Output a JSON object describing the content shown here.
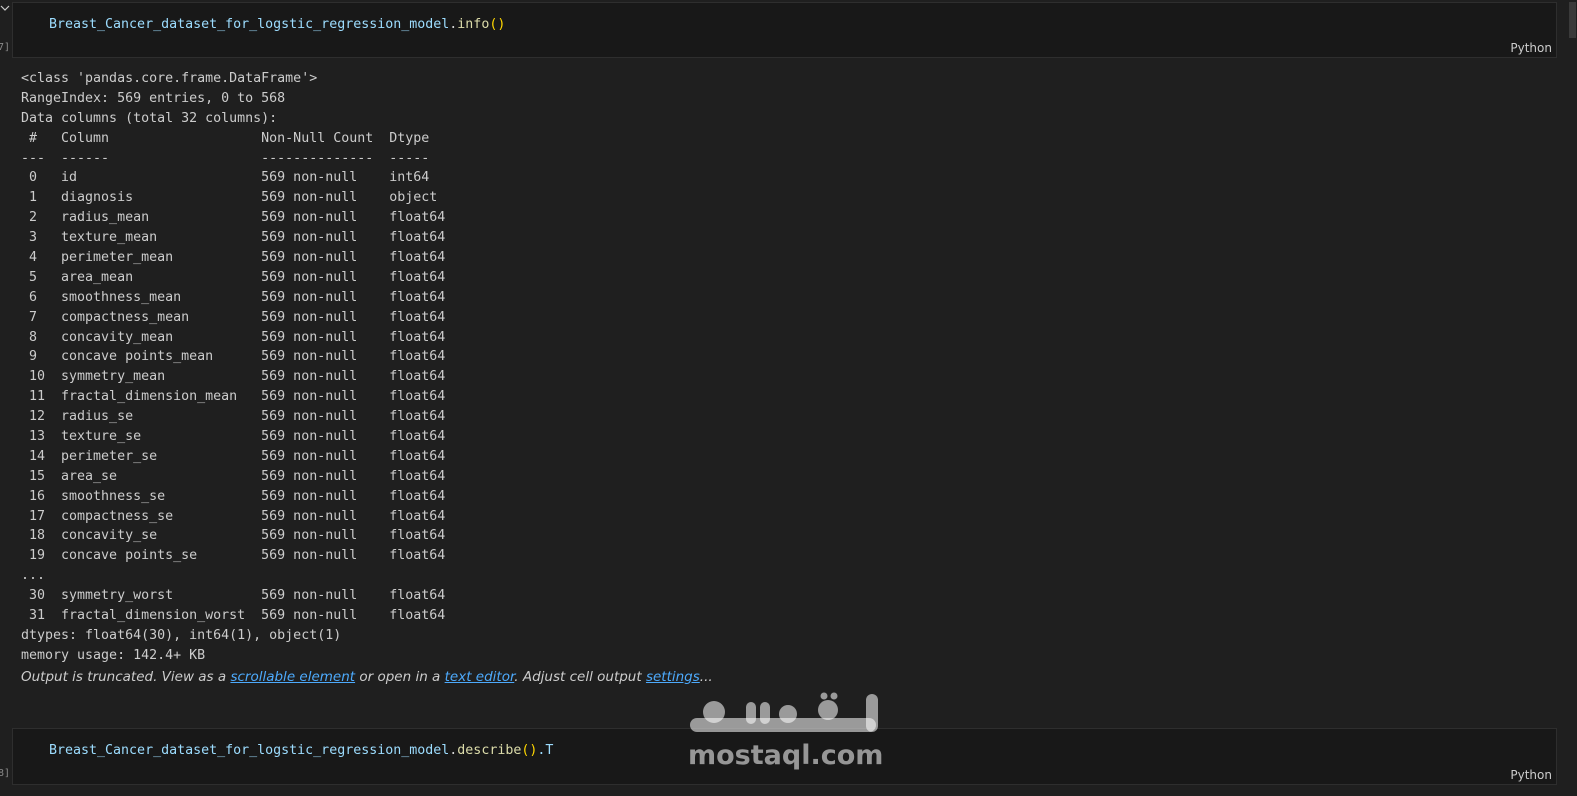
{
  "cells": [
    {
      "exec_label": "7]",
      "code_object": "Breast_Cancer_dataset_for_logstic_regression_model",
      "code_method": "info",
      "code_args": "()",
      "code_suffix": "",
      "language": "Python"
    },
    {
      "exec_label": "8]",
      "code_object": "Breast_Cancer_dataset_for_logstic_regression_model",
      "code_method": "describe",
      "code_args": "()",
      "code_suffix": ".T",
      "language": "Python"
    }
  ],
  "output": {
    "lines": [
      "<class 'pandas.core.frame.DataFrame'>",
      "RangeIndex: 569 entries, 0 to 568",
      "Data columns (total 32 columns):",
      " #   Column                   Non-Null Count  Dtype  ",
      "---  ------                   --------------  -----  ",
      " 0   id                       569 non-null    int64  ",
      " 1   diagnosis                569 non-null    object ",
      " 2   radius_mean              569 non-null    float64",
      " 3   texture_mean             569 non-null    float64",
      " 4   perimeter_mean           569 non-null    float64",
      " 5   area_mean                569 non-null    float64",
      " 6   smoothness_mean          569 non-null    float64",
      " 7   compactness_mean         569 non-null    float64",
      " 8   concavity_mean           569 non-null    float64",
      " 9   concave points_mean      569 non-null    float64",
      " 10  symmetry_mean            569 non-null    float64",
      " 11  fractal_dimension_mean   569 non-null    float64",
      " 12  radius_se                569 non-null    float64",
      " 13  texture_se               569 non-null    float64",
      " 14  perimeter_se             569 non-null    float64",
      " 15  area_se                  569 non-null    float64",
      " 16  smoothness_se            569 non-null    float64",
      " 17  compactness_se           569 non-null    float64",
      " 18  concavity_se             569 non-null    float64",
      " 19  concave points_se        569 non-null    float64",
      "...",
      " 30  symmetry_worst           569 non-null    float64",
      " 31  fractal_dimension_worst  569 non-null    float64",
      "dtypes: float64(30), int64(1), object(1)",
      "memory usage: 142.4+ KB"
    ],
    "truncate": {
      "prefix": "Output is truncated. View as a ",
      "link1": "scrollable element",
      "middle": " or open in a ",
      "link2": "text editor",
      "middle2": ". Adjust cell output ",
      "link3": "settings",
      "suffix": "..."
    }
  },
  "watermark": {
    "arabic": "مستقل",
    "latin": "mostaql.com"
  }
}
